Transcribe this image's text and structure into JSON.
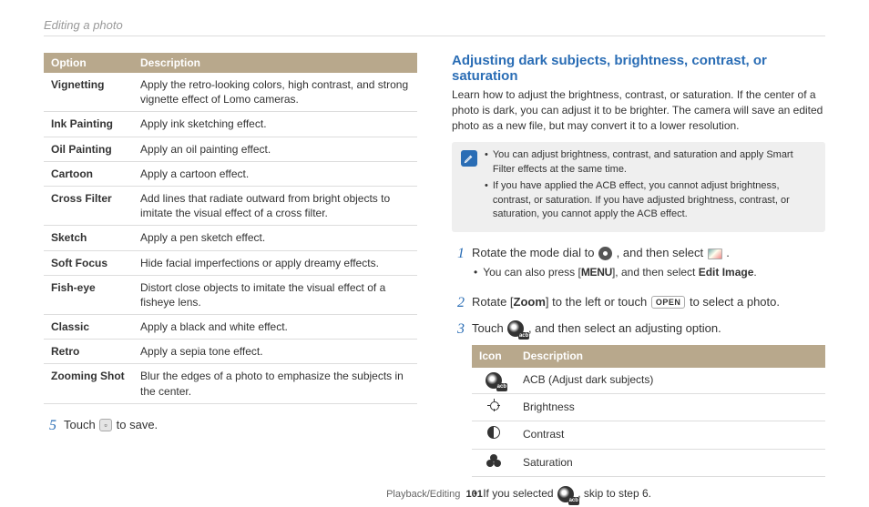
{
  "header": {
    "title": "Editing a photo"
  },
  "left_table": {
    "headers": {
      "option": "Option",
      "description": "Description"
    },
    "rows": [
      {
        "option": "Vignetting",
        "desc": "Apply the retro-looking colors, high contrast, and strong vignette effect of Lomo cameras."
      },
      {
        "option": "Ink Painting",
        "desc": "Apply ink sketching effect."
      },
      {
        "option": "Oil Painting",
        "desc": "Apply an oil painting effect."
      },
      {
        "option": "Cartoon",
        "desc": "Apply a cartoon effect."
      },
      {
        "option": "Cross Filter",
        "desc": "Add lines that radiate outward from bright objects to imitate the visual effect of a cross filter."
      },
      {
        "option": "Sketch",
        "desc": "Apply a pen sketch effect."
      },
      {
        "option": "Soft Focus",
        "desc": "Hide facial imperfections or apply dreamy effects."
      },
      {
        "option": "Fish-eye",
        "desc": "Distort close objects to imitate the visual effect of a fisheye lens."
      },
      {
        "option": "Classic",
        "desc": "Apply a black and white effect."
      },
      {
        "option": "Retro",
        "desc": "Apply a sepia tone effect."
      },
      {
        "option": "Zooming Shot",
        "desc": "Blur the edges of a photo to emphasize the subjects in the center."
      }
    ]
  },
  "step5": {
    "num": "5",
    "pre": "Touch ",
    "post": " to save."
  },
  "right": {
    "title": "Adjusting dark subjects, brightness, contrast, or saturation",
    "intro": "Learn how to adjust the brightness, contrast, or saturation. If the center of a photo is dark, you can adjust it to be brighter. The camera will save an edited photo as a new file, but may convert it to a lower resolution."
  },
  "note": {
    "items": [
      "You can adjust brightness, contrast, and saturation and apply Smart Filter effects at the same time.",
      "If you have applied the ACB effect, you cannot adjust brightness, contrast, or saturation. If you have adjusted brightness, contrast, or saturation, you cannot apply the ACB effect."
    ]
  },
  "steps": {
    "s1": {
      "num": "1",
      "a": "Rotate the mode dial to ",
      "b": ", and then select ",
      "c": ".",
      "sub_a": "You can also press [",
      "sub_menu": "MENU",
      "sub_b": "], and then select ",
      "sub_bold": "Edit Image",
      "sub_c": "."
    },
    "s2": {
      "num": "2",
      "a": "Rotate [",
      "zoom": "Zoom",
      "b": "] to the left or touch ",
      "open": "OPEN",
      "c": " to select a photo."
    },
    "s3": {
      "num": "3",
      "a": "Touch ",
      "b": ", and then select an adjusting option."
    }
  },
  "icon_table": {
    "headers": {
      "icon": "Icon",
      "description": "Description"
    },
    "rows": [
      {
        "desc": "ACB (Adjust dark subjects)"
      },
      {
        "desc": "Brightness"
      },
      {
        "desc": "Contrast"
      },
      {
        "desc": "Saturation"
      }
    ]
  },
  "final_bullet": {
    "a": "If you selected ",
    "b": ", skip to step 6."
  },
  "footer": {
    "section": "Playback/Editing",
    "page": "101"
  }
}
